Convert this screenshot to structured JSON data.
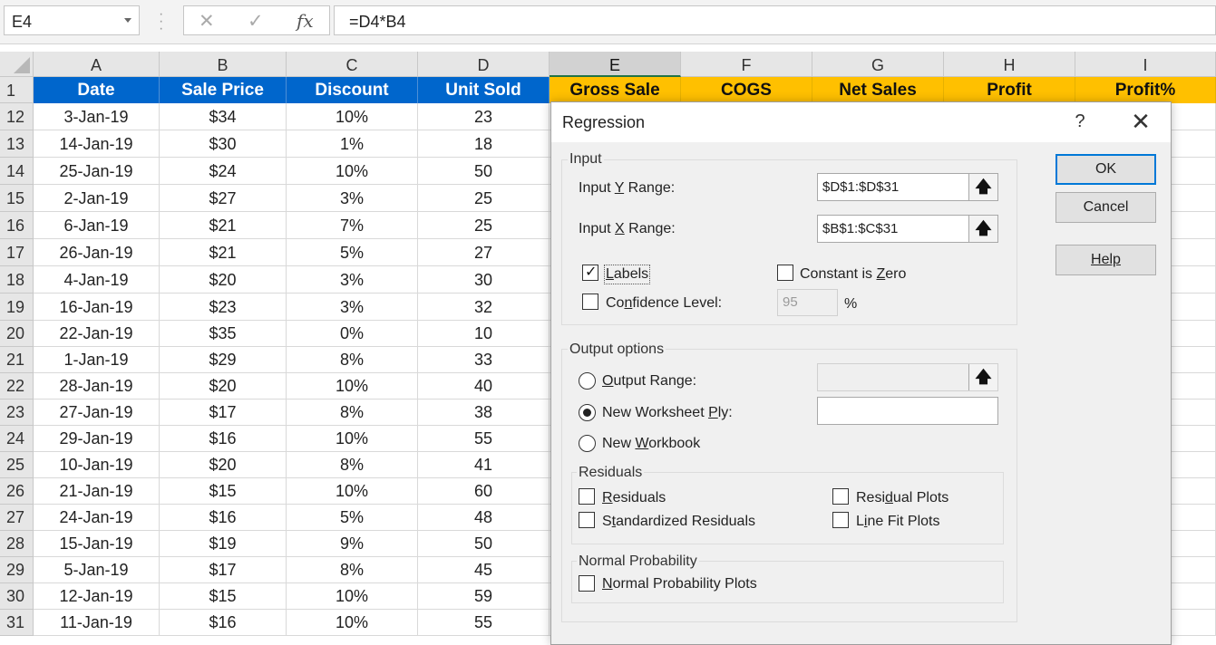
{
  "formula_bar": {
    "name_box": "E4",
    "cancel_icon": "✕",
    "enter_icon": "✓",
    "fx_label": "fx",
    "formula": "=D4*B4"
  },
  "columns": [
    "A",
    "B",
    "C",
    "D",
    "E",
    "F",
    "G",
    "H",
    "I"
  ],
  "selected_column": "E",
  "header_row_number": "1",
  "headers": [
    "Date",
    "Sale Price",
    "Discount",
    "Unit Sold",
    "Gross Sale",
    "COGS",
    "Net Sales",
    "Profit",
    "Profit%"
  ],
  "colors": {
    "header_blue": "#0066cc",
    "header_gold": "#ffc000",
    "selected_col_accent": "#217346",
    "default_button_border": "#0078d7"
  },
  "rows": [
    {
      "num": "12",
      "date": "3-Jan-19",
      "price": "$34",
      "discount": "10%",
      "units": "23"
    },
    {
      "num": "13",
      "date": "14-Jan-19",
      "price": "$30",
      "discount": "1%",
      "units": "18"
    },
    {
      "num": "14",
      "date": "25-Jan-19",
      "price": "$24",
      "discount": "10%",
      "units": "50"
    },
    {
      "num": "15",
      "date": "2-Jan-19",
      "price": "$27",
      "discount": "3%",
      "units": "25"
    },
    {
      "num": "16",
      "date": "6-Jan-19",
      "price": "$21",
      "discount": "7%",
      "units": "25"
    },
    {
      "num": "17",
      "date": "26-Jan-19",
      "price": "$21",
      "discount": "5%",
      "units": "27"
    },
    {
      "num": "18",
      "date": "4-Jan-19",
      "price": "$20",
      "discount": "3%",
      "units": "30"
    },
    {
      "num": "19",
      "date": "16-Jan-19",
      "price": "$23",
      "discount": "3%",
      "units": "32"
    },
    {
      "num": "20",
      "date": "22-Jan-19",
      "price": "$35",
      "discount": "0%",
      "units": "10"
    },
    {
      "num": "21",
      "date": "1-Jan-19",
      "price": "$29",
      "discount": "8%",
      "units": "33"
    },
    {
      "num": "22",
      "date": "28-Jan-19",
      "price": "$20",
      "discount": "10%",
      "units": "40"
    },
    {
      "num": "23",
      "date": "27-Jan-19",
      "price": "$17",
      "discount": "8%",
      "units": "38"
    },
    {
      "num": "24",
      "date": "29-Jan-19",
      "price": "$16",
      "discount": "10%",
      "units": "55"
    },
    {
      "num": "25",
      "date": "10-Jan-19",
      "price": "$20",
      "discount": "8%",
      "units": "41"
    },
    {
      "num": "26",
      "date": "21-Jan-19",
      "price": "$15",
      "discount": "10%",
      "units": "60"
    },
    {
      "num": "27",
      "date": "24-Jan-19",
      "price": "$16",
      "discount": "5%",
      "units": "48"
    },
    {
      "num": "28",
      "date": "15-Jan-19",
      "price": "$19",
      "discount": "9%",
      "units": "50"
    },
    {
      "num": "29",
      "date": "5-Jan-19",
      "price": "$17",
      "discount": "8%",
      "units": "45"
    },
    {
      "num": "30",
      "date": "12-Jan-19",
      "price": "$15",
      "discount": "10%",
      "units": "59"
    },
    {
      "num": "31",
      "date": "11-Jan-19",
      "price": "$16",
      "discount": "10%",
      "units": "55"
    }
  ],
  "dialog": {
    "title": "Regression",
    "help_icon": "?",
    "close_icon": "✕",
    "input_group": "Input",
    "input_y_pre": "Input ",
    "input_y_ul": "Y",
    "input_y_post": " Range:",
    "input_y_value": "$D$1:$D$31",
    "input_x_pre": "Input ",
    "input_x_ul": "X",
    "input_x_post": " Range:",
    "input_x_value": "$B$1:$C$31",
    "range_picker_icon": "🡅",
    "labels_ul": "L",
    "labels_rest": "abels",
    "labels_checked": true,
    "constant_pre": "Constant is ",
    "constant_ul": "Z",
    "constant_post": "ero",
    "confidence_pre": "Co",
    "confidence_ul": "n",
    "confidence_post": "fidence Level:",
    "confidence_value": "95",
    "percent": "%",
    "output_group": "Output options",
    "output_range_ul": "O",
    "output_range_rest": "utput Range:",
    "new_ply_pre": "New Worksheet ",
    "new_ply_ul": "P",
    "new_ply_post": "ly:",
    "new_ply_selected": true,
    "new_workbook_pre": "New ",
    "new_workbook_ul": "W",
    "new_workbook_post": "orkbook",
    "residuals_group": "Residuals",
    "residuals_ul": "R",
    "residuals_rest": "esiduals",
    "std_residuals_pre": "S",
    "std_residuals_ul": "t",
    "std_residuals_post": "andardized Residuals",
    "residual_plots_pre": "Resi",
    "residual_plots_ul": "d",
    "residual_plots_post": "ual Plots",
    "line_fit_pre": "L",
    "line_fit_ul": "i",
    "line_fit_post": "ne Fit Plots",
    "normal_group": "Normal Probability",
    "normal_plots_ul": "N",
    "normal_plots_rest": "ormal Probability Plots",
    "ok": "OK",
    "cancel": "Cancel",
    "help": "Help"
  }
}
